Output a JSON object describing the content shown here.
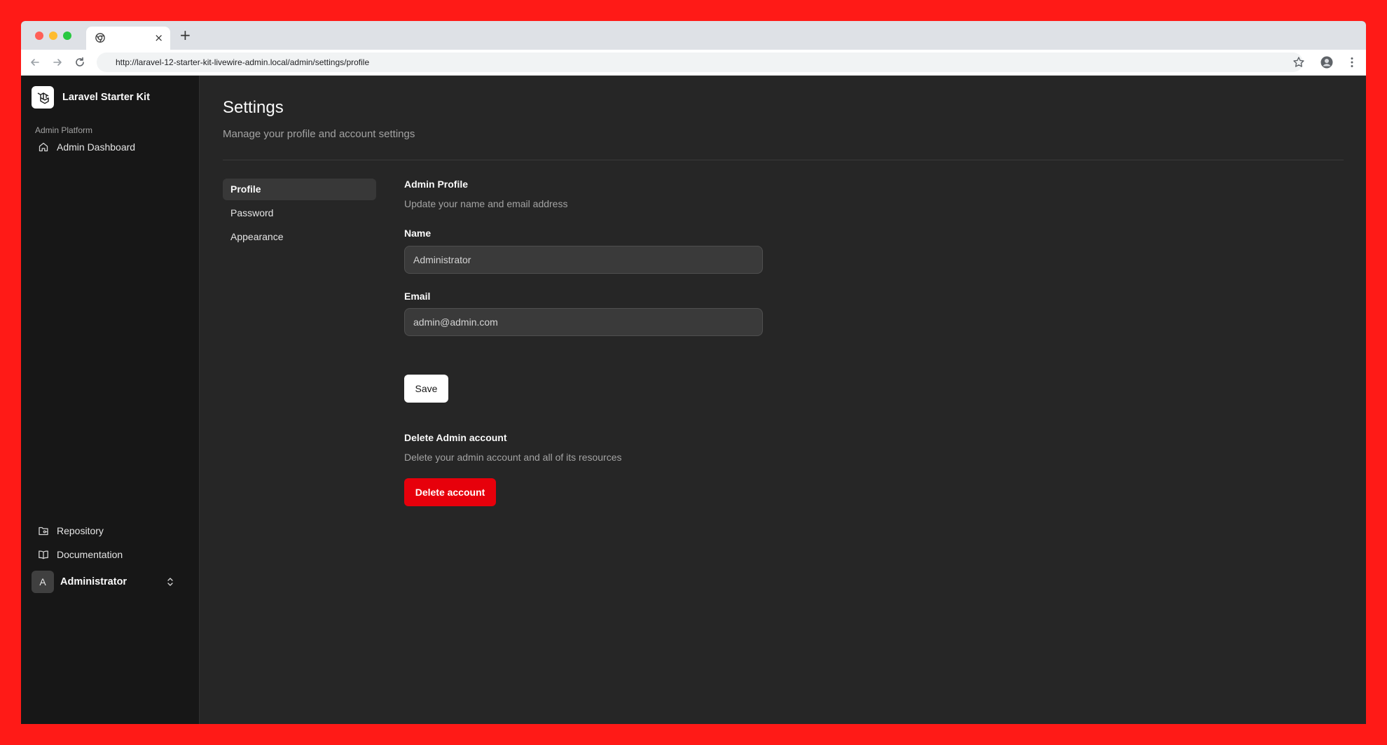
{
  "browser": {
    "tab_title": "",
    "tab_close_glyph": "×",
    "new_tab_glyph": "+",
    "url": "http://laravel-12-starter-kit-livewire-admin.local/admin/settings/profile"
  },
  "sidebar": {
    "brand": "Laravel Starter Kit",
    "group_label": "Admin Platform",
    "nav": [
      {
        "label": "Admin Dashboard",
        "icon": "home-icon"
      }
    ],
    "footer_links": [
      {
        "label": "Repository",
        "icon": "folder-git-icon"
      },
      {
        "label": "Documentation",
        "icon": "book-open-icon"
      }
    ],
    "user": {
      "initial": "A",
      "name": "Administrator"
    }
  },
  "page": {
    "title": "Settings",
    "subtitle": "Manage your profile and account settings"
  },
  "settings_nav": [
    {
      "label": "Profile",
      "active": true
    },
    {
      "label": "Password",
      "active": false
    },
    {
      "label": "Appearance",
      "active": false
    }
  ],
  "profile": {
    "title": "Admin Profile",
    "description": "Update your name and email address",
    "name_label": "Name",
    "name_value": "Administrator",
    "email_label": "Email",
    "email_value": "admin@admin.com",
    "save_label": "Save"
  },
  "delete": {
    "title": "Delete Admin account",
    "description": "Delete your admin account and all of its resources",
    "button_label": "Delete account"
  },
  "colors": {
    "frame": "#ff1a17",
    "sidebar_bg": "#171717",
    "main_bg": "#262626",
    "danger": "#e7000b"
  }
}
